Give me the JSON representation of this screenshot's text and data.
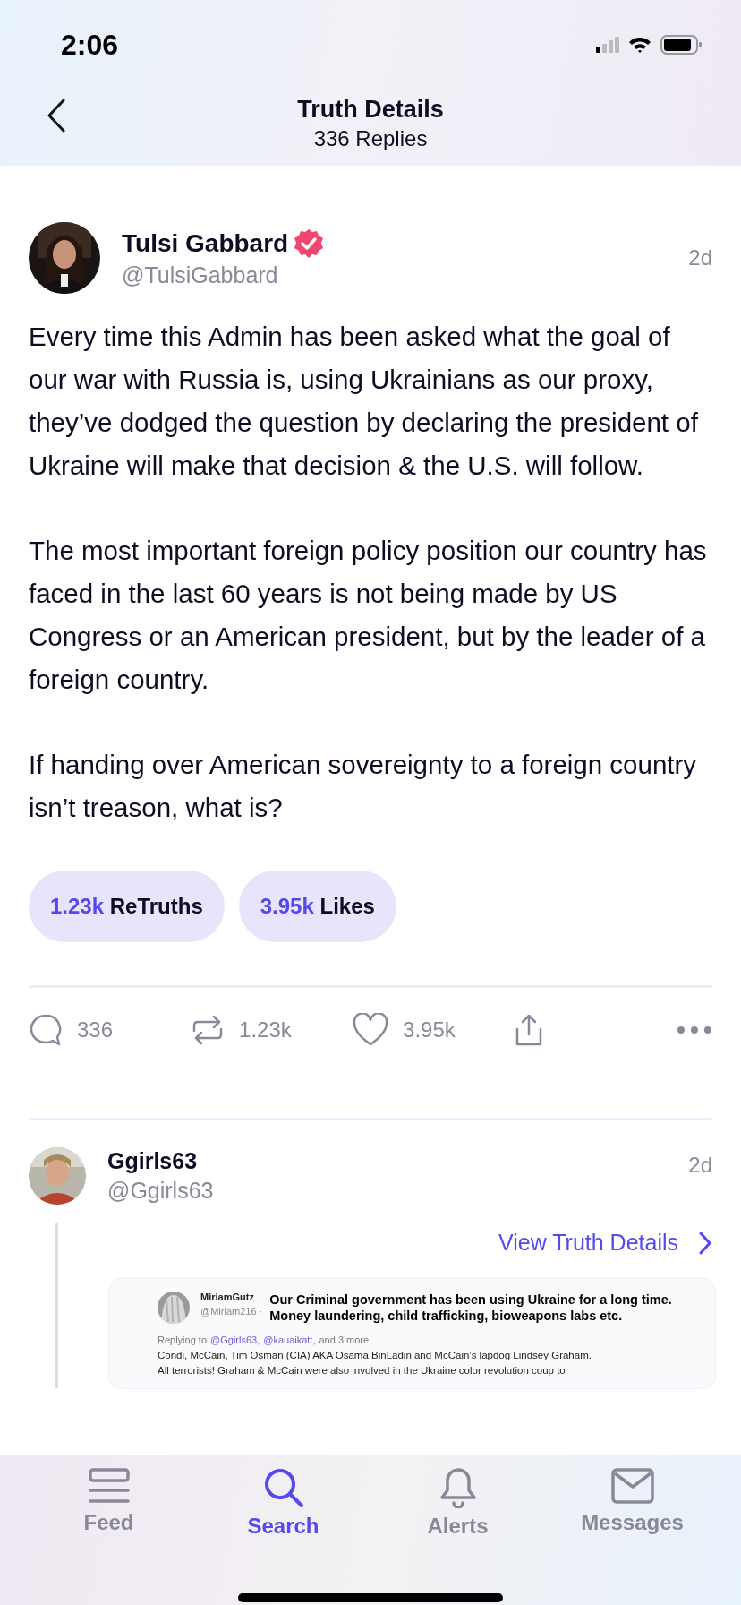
{
  "status_bar": {
    "time": "2:06"
  },
  "header": {
    "title": "Truth Details",
    "subtitle": "336 Replies"
  },
  "post": {
    "author": {
      "name": "Tulsi Gabbard",
      "handle": "@TulsiGabbard",
      "verified": true
    },
    "time": "2d",
    "paragraphs": [
      "Every time this Admin has been asked what the goal of our war with Russia is, using Ukrainians as our proxy, they’ve dodged the question by declaring the president of Ukraine will make that decision & the U.S. will follow.",
      "The most important foreign policy position our country has faced in the last 60 years is not being made by US Congress or an American president, but by the leader of a foreign country.",
      "If handing over American sovereignty to a foreign country isn’t treason, what is?"
    ],
    "stats": [
      {
        "count": "1.23k",
        "label": "ReTruths"
      },
      {
        "count": "3.95k",
        "label": "Likes"
      }
    ],
    "actions": [
      {
        "kind": "reply",
        "count": "336"
      },
      {
        "kind": "retruth",
        "count": "1.23k"
      },
      {
        "kind": "like",
        "count": "3.95k"
      },
      {
        "kind": "share"
      },
      {
        "kind": "more"
      }
    ]
  },
  "reply": {
    "author": {
      "name": "Ggirls63",
      "handle": "@Ggirls63"
    },
    "time": "2d",
    "link": "View Truth Details",
    "embedded": {
      "name": "MiriamGutz",
      "handle": "@Miriam216 ·",
      "headline_lines": [
        "Our Criminal government has been using Ukraine for a long time.",
        "Money laundering, child trafficking, bioweapons labs etc."
      ],
      "replying_prefix": "Replying to",
      "mentions": [
        "@Ggirls63,",
        "@kauaikatt,"
      ],
      "replying_suffix": "and 3 more",
      "body_lines": [
        "Condi, McCain, Tim Osman (CIA) AKA Osama BinLadin and McCain’s lapdog Lindsey Graham.",
        "All terrorists! Graham & McCain were also involved in the Ukraine color revolution coup to"
      ]
    }
  },
  "tabs": [
    {
      "kind": "feed",
      "label": "Feed",
      "selected": false
    },
    {
      "kind": "search",
      "label": "Search",
      "selected": true
    },
    {
      "kind": "alerts",
      "label": "Alerts",
      "selected": false
    },
    {
      "kind": "messages",
      "label": "Messages",
      "selected": false
    }
  ]
}
